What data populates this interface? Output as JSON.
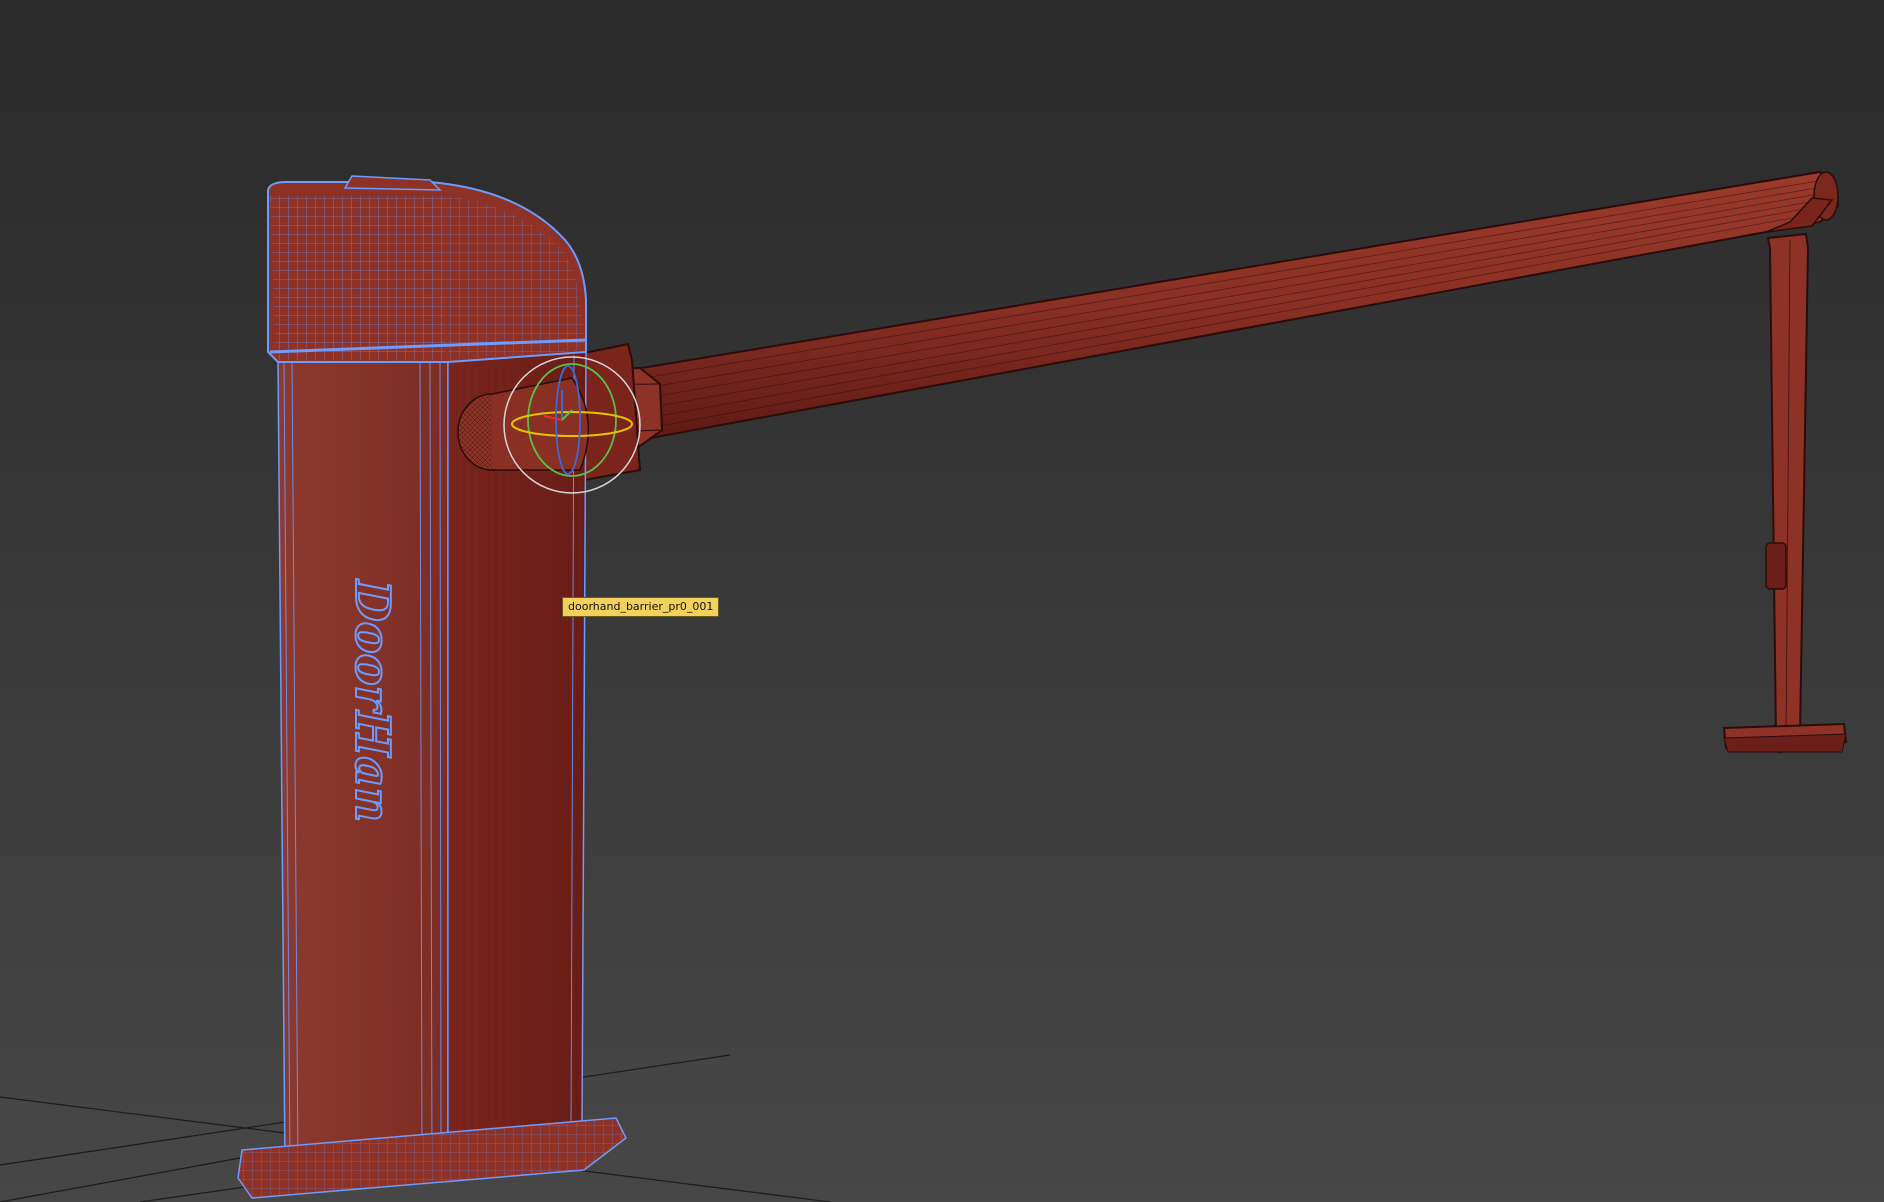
{
  "viewport": {
    "tooltip_object_name": "doorhand_barrier_pr0_001",
    "logo_text": "DoorHan",
    "colors": {
      "background_top": "#2a2a2a",
      "background_bottom": "#474747",
      "model_red": "#8e3227",
      "model_red_dark": "#6b1f18",
      "wire_edges": "#2a0d0a",
      "selection_wire": "#6e9bff",
      "tooltip_bg": "#f2d25a"
    },
    "icons": [
      "rotate-gizmo-icon",
      "pivot-axis-icon"
    ]
  }
}
